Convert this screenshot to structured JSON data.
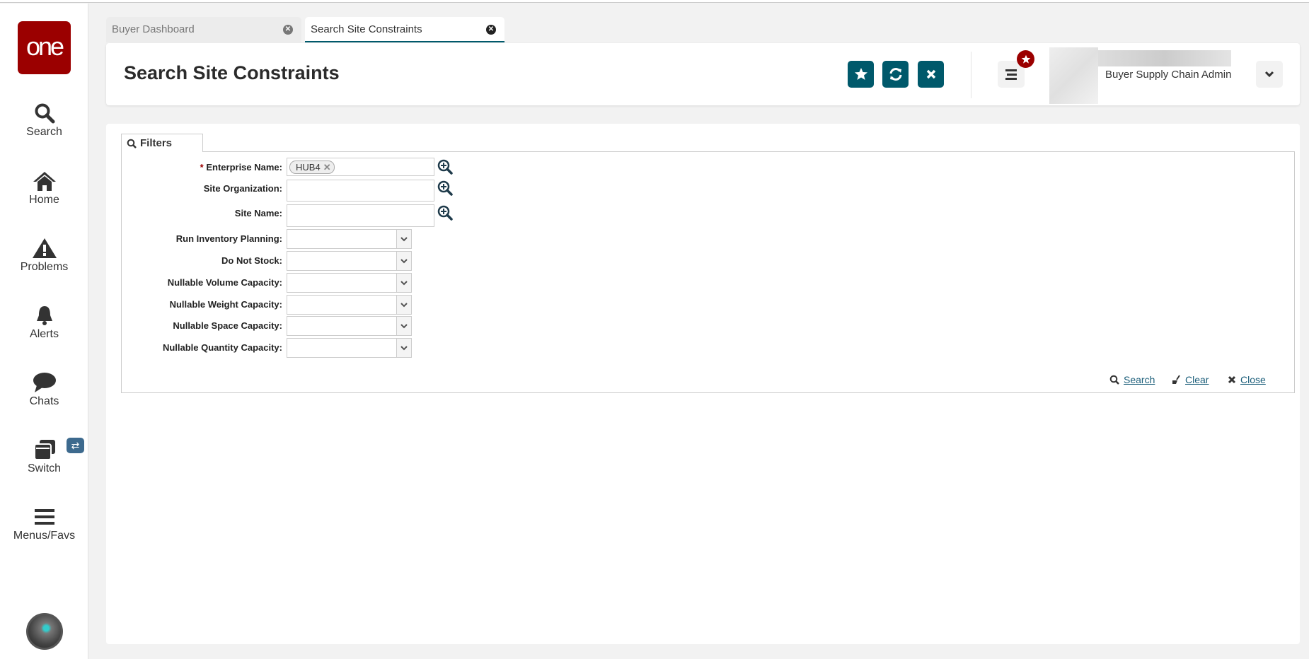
{
  "brand": {
    "logo_text": "one",
    "logo_color": "#9b0000",
    "accent": "#00596b"
  },
  "sidebar": {
    "items": [
      {
        "label": "Search",
        "icon": "search-icon"
      },
      {
        "label": "Home",
        "icon": "home-icon"
      },
      {
        "label": "Problems",
        "icon": "warning-icon"
      },
      {
        "label": "Alerts",
        "icon": "bell-icon"
      },
      {
        "label": "Chats",
        "icon": "chat-icon"
      },
      {
        "label": "Switch",
        "icon": "switch-icon",
        "badge": "⇄"
      },
      {
        "label": "Menus/Favs",
        "icon": "menu-icon"
      }
    ]
  },
  "tabs": [
    {
      "label": "Buyer Dashboard",
      "active": false
    },
    {
      "label": "Search Site Constraints",
      "active": true
    }
  ],
  "header": {
    "title": "Search Site Constraints",
    "user_role": "Buyer Supply Chain Admin"
  },
  "filters": {
    "tab_label": "Filters",
    "required_mark": "*",
    "fields": [
      {
        "label": "Enterprise Name:",
        "type": "lookup",
        "value_chip": "HUB4",
        "required": true
      },
      {
        "label": "Site Organization:",
        "type": "lookup",
        "value": ""
      },
      {
        "label": "Site Name:",
        "type": "lookup",
        "value": ""
      },
      {
        "label": "Run Inventory Planning:",
        "type": "select",
        "value": ""
      },
      {
        "label": "Do Not Stock:",
        "type": "select",
        "value": ""
      },
      {
        "label": "Nullable Volume Capacity:",
        "type": "select",
        "value": ""
      },
      {
        "label": "Nullable Weight Capacity:",
        "type": "select",
        "value": ""
      },
      {
        "label": "Nullable Space Capacity:",
        "type": "select",
        "value": ""
      },
      {
        "label": "Nullable Quantity Capacity:",
        "type": "select",
        "value": ""
      }
    ],
    "actions": {
      "search": "Search",
      "clear": "Clear",
      "close": "Close"
    }
  }
}
